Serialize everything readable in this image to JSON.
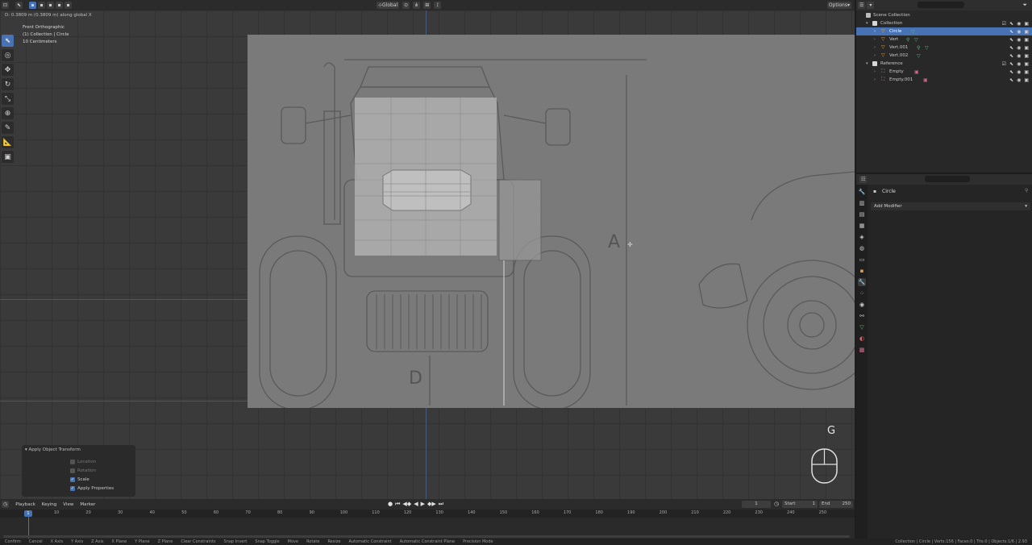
{
  "viewport": {
    "status_line": "D: 0.3809 m (0.3809 m) along global X",
    "view_name": "Front Orthographic",
    "collection_path": "(1) Collection | Circle",
    "scale": "10 Centimeters",
    "header_orientation": "Global",
    "options_label": "Options",
    "key_overlay": "G",
    "reference_labels": [
      "A",
      "D"
    ]
  },
  "operator_panel": {
    "title": "Apply Object Transform",
    "rows": [
      {
        "label": "Location",
        "checked": false
      },
      {
        "label": "Rotation",
        "checked": false
      },
      {
        "label": "Scale",
        "checked": true
      },
      {
        "label": "Apply Properties",
        "checked": true
      }
    ]
  },
  "outliner": {
    "rows": [
      {
        "label": "Scene Collection",
        "depth": 0
      },
      {
        "label": "Collection",
        "depth": 1
      },
      {
        "label": "Circle",
        "depth": 2,
        "selected": true
      },
      {
        "label": "Vert",
        "depth": 2
      },
      {
        "label": "Vert.001",
        "depth": 2
      },
      {
        "label": "Vert.002",
        "depth": 2
      },
      {
        "label": "Reference",
        "depth": 1
      },
      {
        "label": "Empty",
        "depth": 2
      },
      {
        "label": "Empty.001",
        "depth": 2
      }
    ]
  },
  "properties": {
    "object_name": "Circle",
    "add_modifier_label": "Add Modifier"
  },
  "timeline": {
    "menus": [
      "Playback",
      "Keying",
      "View",
      "Marker"
    ],
    "current_frame": "1",
    "frame_display": "1",
    "start_label": "Start",
    "start_value": "1",
    "end_label": "End",
    "end_value": "250",
    "ticks": [
      "10",
      "20",
      "30",
      "40",
      "50",
      "60",
      "70",
      "80",
      "90",
      "100",
      "110",
      "120",
      "130",
      "140",
      "150",
      "160",
      "170",
      "180",
      "190",
      "200",
      "210",
      "220",
      "230",
      "240",
      "250"
    ]
  },
  "statusbar": {
    "items": [
      "Confirm",
      "Cancel",
      "X Axis",
      "Y Axis",
      "Z Axis",
      "X Plane",
      "Y Plane",
      "Z Plane",
      "Clear Constraints",
      "Snap Invert",
      "Snap Toggle",
      "Move",
      "Rotate",
      "Resize",
      "Automatic Constraint",
      "Automatic Constraint Plane",
      "Precision Mode"
    ],
    "right": "Collection | Circle | Verts:156 | Faces:0 | Tris:0 | Objects:1/6 | 2.93"
  },
  "colors": {
    "accent": "#4772b3",
    "panel": "#282828",
    "viewport": "#3a3a3a",
    "x_axis": "#8a4a4a"
  }
}
